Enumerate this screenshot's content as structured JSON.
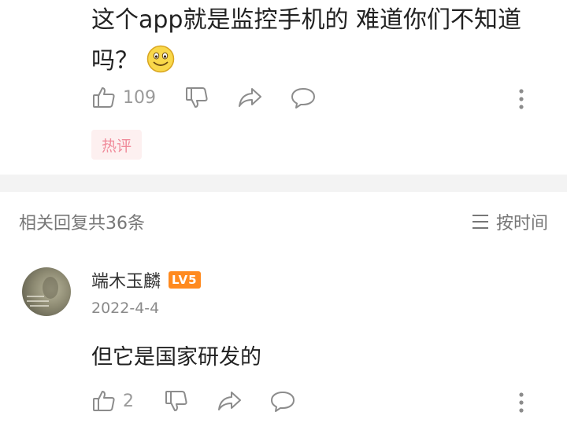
{
  "comment": {
    "text": "这个app就是监控手机的 难道你们不知道吗？",
    "emoji": "smiley-emoji",
    "like_count": "109",
    "badge": "热评"
  },
  "replies_header": {
    "title": "相关回复共36条",
    "sort_label": "按时间"
  },
  "reply": {
    "username": "端木玉麟",
    "level": "LV5",
    "date": "2022-4-4",
    "text": "但它是国家研发的",
    "like_count": "2"
  },
  "colors": {
    "icon": "#8c8c8c",
    "badge_bg": "#fdf0f0",
    "badge_text": "#f08a9a",
    "level_bg": "#ff8a1f",
    "divider": "#f3f3f3"
  }
}
